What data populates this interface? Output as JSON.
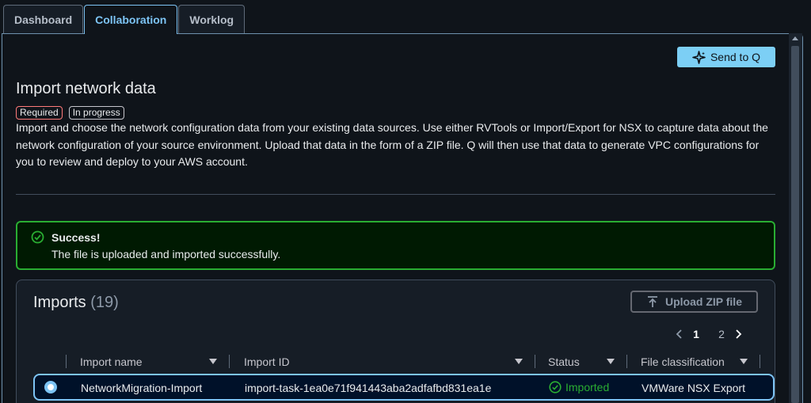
{
  "tabs": [
    {
      "label": "Dashboard"
    },
    {
      "label": "Collaboration"
    },
    {
      "label": "Worklog"
    }
  ],
  "header": {
    "send_label": "Send to Q",
    "title": "Import network data",
    "badge_required": "Required",
    "badge_status": "In progress",
    "description": "Import and choose the network configuration data from your existing data sources. Use either RVTools or Import/Export for NSX to capture data about the network configuration of your source environment. Upload that data in the form of a ZIP file. Q will then use that data to generate VPC configurations for you to review and deploy to your AWS account."
  },
  "alert": {
    "title": "Success!",
    "message": "The file is uploaded and imported successfully."
  },
  "imports": {
    "title": "Imports",
    "count": "(19)",
    "upload_label": "Upload ZIP file",
    "pages": [
      "1",
      "2"
    ],
    "current_page": "1",
    "columns": [
      "Import name",
      "Import ID",
      "Status",
      "File classification"
    ],
    "rows": [
      {
        "name": "NetworkMigration-Import",
        "id": "import-task-1ea0e71f941443aba2adfafbd831ea1e",
        "status": "Imported",
        "classification": "VMWare NSX Export"
      }
    ]
  },
  "colors": {
    "accent": "#7dc4f5",
    "success": "#29ad32",
    "required": "#ff7a7a",
    "send_button": "#7ccff5"
  }
}
